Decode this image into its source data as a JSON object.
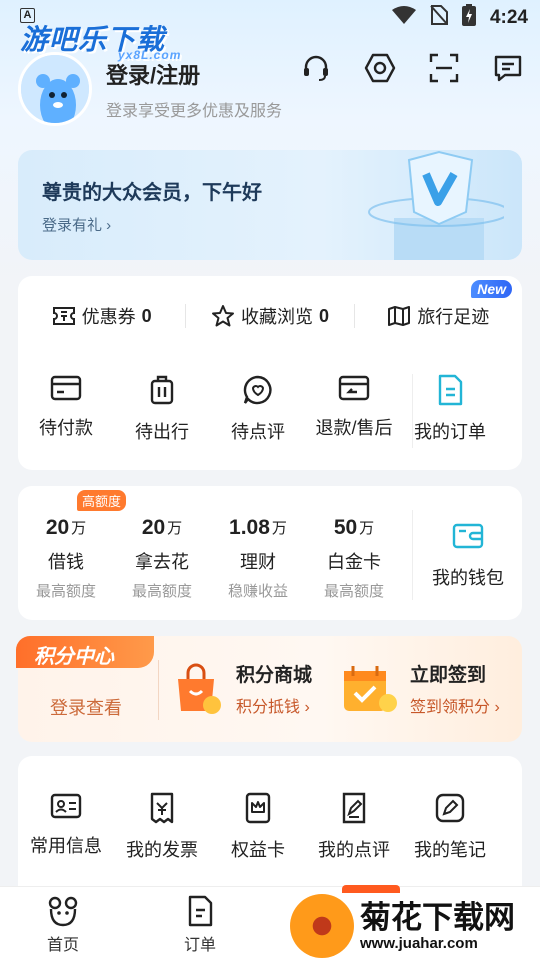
{
  "status_bar": {
    "time": "4:24",
    "app_badge": "A"
  },
  "watermark": {
    "text": "游吧乐下载",
    "sub": "yx8L.com"
  },
  "profile": {
    "title": "登录/注册",
    "subtitle": "登录享受更多优惠及服务"
  },
  "top_icons": [
    "headset-icon",
    "settings-hexagon-icon",
    "scan-icon",
    "message-icon"
  ],
  "member_banner": {
    "title": "尊贵的大众会员，下午好",
    "link": "登录有礼 ›"
  },
  "quick_links": [
    {
      "label": "优惠券",
      "count": "0",
      "icon": "ticket-icon"
    },
    {
      "label": "收藏浏览",
      "count": "0",
      "icon": "star-icon"
    },
    {
      "label": "旅行足迹",
      "icon": "map-icon",
      "badge": "New"
    }
  ],
  "orders": [
    {
      "label": "待付款",
      "icon": "card-icon"
    },
    {
      "label": "待出行",
      "icon": "luggage-icon"
    },
    {
      "label": "待点评",
      "icon": "comment-icon"
    },
    {
      "label": "退款/售后",
      "icon": "refund-icon"
    },
    {
      "label": "我的订单",
      "icon": "order-doc-icon"
    }
  ],
  "finance": {
    "badge": "高额度",
    "items": [
      {
        "value": "20",
        "unit": "万",
        "name": "借钱",
        "desc": "最高额度"
      },
      {
        "value": "20",
        "unit": "万",
        "name": "拿去花",
        "desc": "最高额度"
      },
      {
        "value": "1.08",
        "unit": "万",
        "name": "理财",
        "desc": "稳赚收益"
      },
      {
        "value": "50",
        "unit": "万",
        "name": "白金卡",
        "desc": "最高额度"
      }
    ],
    "wallet": "我的钱包"
  },
  "points": {
    "tag": "积分中心",
    "login": "登录查看",
    "mall": {
      "title": "积分商城",
      "sub": "积分抵钱 ›"
    },
    "signin": {
      "title": "立即签到",
      "sub": "签到领积分 ›"
    }
  },
  "services": [
    {
      "label": "常用信息",
      "icon": "id-card-icon"
    },
    {
      "label": "我的发票",
      "icon": "invoice-icon"
    },
    {
      "label": "权益卡",
      "icon": "crown-card-icon"
    },
    {
      "label": "我的点评",
      "icon": "review-edit-icon"
    },
    {
      "label": "我的笔记",
      "icon": "note-pen-icon"
    }
  ],
  "tabbar": [
    {
      "label": "首页",
      "icon": "home-mascot-icon"
    },
    {
      "label": "订单",
      "icon": "order-tab-icon"
    }
  ],
  "juhar": {
    "name": "菊花下载网",
    "url": "www.juahar.com"
  },
  "colors": {
    "accent_blue": "#1a6fd8",
    "orange": "#ff7a2e",
    "icon_teal": "#22b5d6"
  }
}
